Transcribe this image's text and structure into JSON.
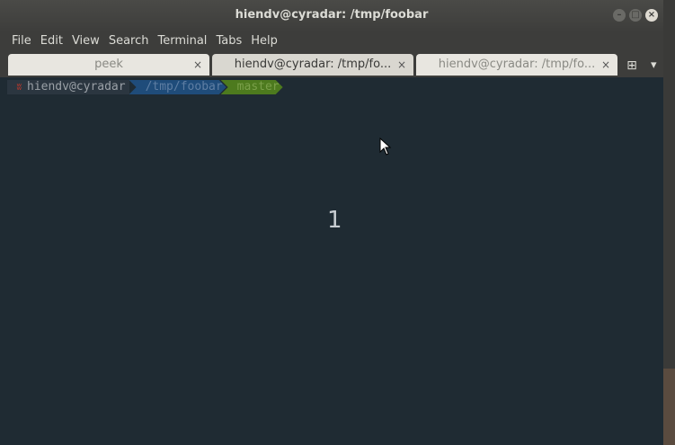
{
  "window": {
    "title": "hiendv@cyradar: /tmp/foobar",
    "controls": {
      "minimize": "–",
      "maximize": "□",
      "close": "×"
    }
  },
  "menu": {
    "items": [
      "File",
      "Edit",
      "View",
      "Search",
      "Terminal",
      "Tabs",
      "Help"
    ]
  },
  "tabs": [
    {
      "label": "peek",
      "state": "inactive"
    },
    {
      "label": "hiendv@cyradar: /tmp/fo...",
      "state": "active"
    },
    {
      "label": "hiendv@cyradar: /tmp/fo...",
      "state": "inactive"
    }
  ],
  "tab_close_glyph": "×",
  "new_tab_glyph": "⊞",
  "tab_menu_glyph": "▾",
  "prompt": {
    "icon": "ʬ",
    "user": "hiendv@cyradar",
    "path": "/tmp/foobar",
    "git": "master"
  },
  "terminal": {
    "counter": "1"
  },
  "colors": {
    "terminal_bg": "#1f2b33",
    "path_segment": "#1f4c7a",
    "git_segment": "#4d7a1e"
  }
}
